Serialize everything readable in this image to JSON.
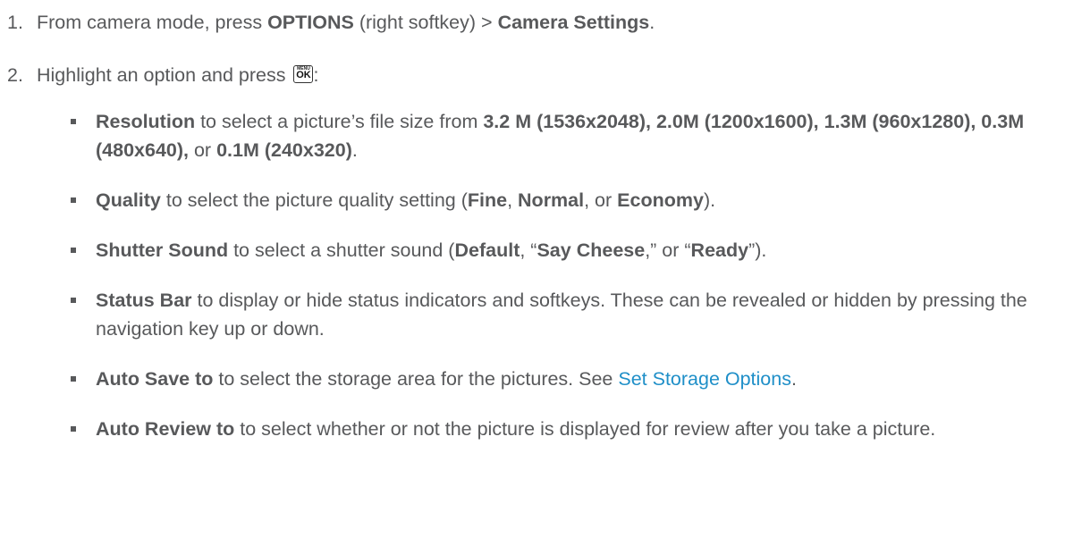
{
  "steps": [
    {
      "num": "1.",
      "pre": "From camera mode, press ",
      "b1": "OPTIONS",
      "mid": " (right softkey) > ",
      "b2": "Camera Settings",
      "post": "."
    },
    {
      "num": "2.",
      "pre": "Highlight an option and press ",
      "key_menu": "MENU",
      "key_ok": "OK",
      "post": ":"
    }
  ],
  "bullets": {
    "resolution": {
      "term": "Resolution",
      "t1": " to select a picture’s file size from ",
      "v1": "3.2 M (1536x2048), 2.0M (1200x1600), 1.3M (960x1280), 0.3M (480x640),",
      "t2": " or ",
      "v2": "0.1M (240x320)",
      "t3": "."
    },
    "quality": {
      "term": "Quality",
      "t1": " to select the picture quality setting (",
      "v1": "Fine",
      "t2": ", ",
      "v2": "Normal",
      "t3": ", or ",
      "v3": "Economy",
      "t4": ")."
    },
    "shutter": {
      "term": "Shutter Sound",
      "t1": " to select a shutter sound (",
      "v1": "Default",
      "t2": ", “",
      "v2": "Say Cheese",
      "t3": ",” or “",
      "v3": "Ready",
      "t4": "”)."
    },
    "status_bar": {
      "term": "Status Bar",
      "t1": " to display or hide status indicators and softkeys. These can be revealed or hidden by pressing the navigation key up or down."
    },
    "auto_save": {
      "term": "Auto Save to",
      "t1": " to select the storage area for the pictures. See ",
      "link": "Set Storage Options",
      "t2": "."
    },
    "auto_review": {
      "term": "Auto Review to",
      "t1": " to select whether or not the picture is displayed for review after you take a picture."
    }
  }
}
